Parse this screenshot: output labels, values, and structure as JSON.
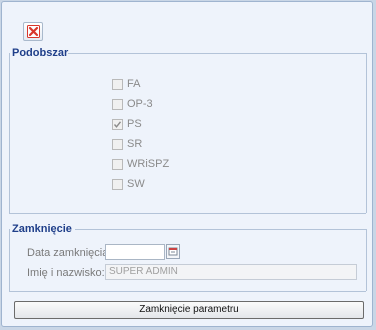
{
  "toolbar": {
    "close_icon": "close-icon"
  },
  "sections": {
    "podobszar": {
      "title": "Podobszar",
      "options": [
        {
          "label": "FA",
          "checked": false
        },
        {
          "label": "OP-3",
          "checked": false
        },
        {
          "label": "PS",
          "checked": true
        },
        {
          "label": "SR",
          "checked": false
        },
        {
          "label": "WRiSPZ",
          "checked": false
        },
        {
          "label": "SW",
          "checked": false
        }
      ]
    },
    "zamkniecie": {
      "title": "Zamknięcie",
      "date_label": "Data zamknięcia:",
      "date_value": "",
      "name_label": "Imię i nazwisko:",
      "name_value": "SUPER ADMIN"
    }
  },
  "footer": {
    "button_label": "Zamknięcie parametru"
  },
  "colors": {
    "accent": "#1f3f8a",
    "close_red": "#d9362b"
  }
}
